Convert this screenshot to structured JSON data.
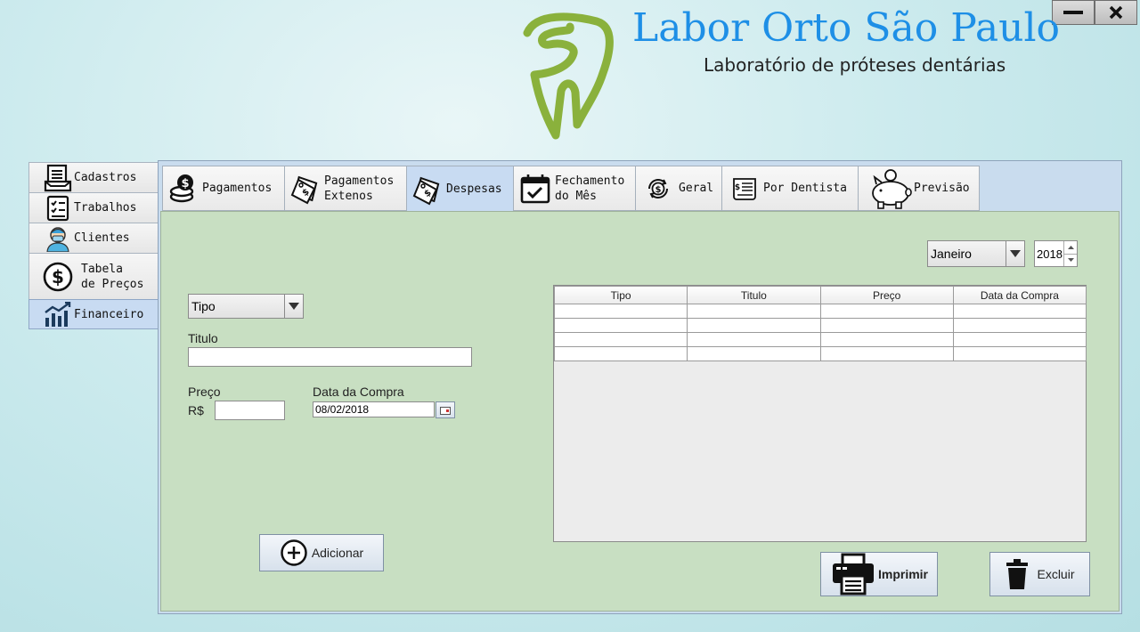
{
  "header": {
    "title": "Labor Orto São Paulo",
    "subtitle": "Laboratório de próteses dentárias"
  },
  "window": {
    "minimize_icon": "minimize-icon",
    "close_icon": "close-icon"
  },
  "sidebar": {
    "items": [
      {
        "label": "Cadastros",
        "icon": "register-form-icon"
      },
      {
        "label": "Trabalhos",
        "icon": "checklist-icon"
      },
      {
        "label": "Clientes",
        "icon": "dentist-icon"
      },
      {
        "label_line1": "Tabela",
        "label_line2": "de Preços",
        "icon": "dollar-coin-icon"
      },
      {
        "label": "Financeiro",
        "icon": "growth-chart-icon",
        "active": true
      }
    ]
  },
  "tabs": [
    {
      "label": "Pagamentos",
      "icon": "coins-icon"
    },
    {
      "label_line1": "Pagamentos",
      "label_line2": "Extenos",
      "icon": "price-tags-icon"
    },
    {
      "label": "Despesas",
      "icon": "price-tags-icon",
      "active": true
    },
    {
      "label_line1": "Fechamento",
      "label_line2": "do Mês",
      "icon": "calendar-check-icon"
    },
    {
      "label": "Geral",
      "icon": "dollar-cycle-icon"
    },
    {
      "label": "Por Dentista",
      "icon": "invoice-icon"
    },
    {
      "label": "Previsão",
      "icon": "piggy-bank-icon"
    }
  ],
  "filters": {
    "month": "Janeiro",
    "year": "2018"
  },
  "form": {
    "tipo_value": "Tipo",
    "titulo_label": "Titulo",
    "titulo_value": "",
    "preco_label": "Preço",
    "currency": "R$",
    "preco_value": "",
    "data_label": "Data da Compra",
    "data_value": "08/02/2018",
    "add_label": "Adicionar"
  },
  "table": {
    "columns": [
      "Tipo",
      "Titulo",
      "Preço",
      "Data da Compra"
    ],
    "rows": [
      [
        "",
        "",
        "",
        ""
      ],
      [
        "",
        "",
        "",
        ""
      ],
      [
        "",
        "",
        "",
        ""
      ],
      [
        "",
        "",
        "",
        ""
      ]
    ]
  },
  "actions": {
    "print_label": "Imprimir",
    "delete_label": "Excluir"
  },
  "colors": {
    "title_blue": "#1e8fe6",
    "logo_green": "#8ab13c",
    "panel_green": "#c8dfc2",
    "active_tab": "#c8dbf2"
  }
}
